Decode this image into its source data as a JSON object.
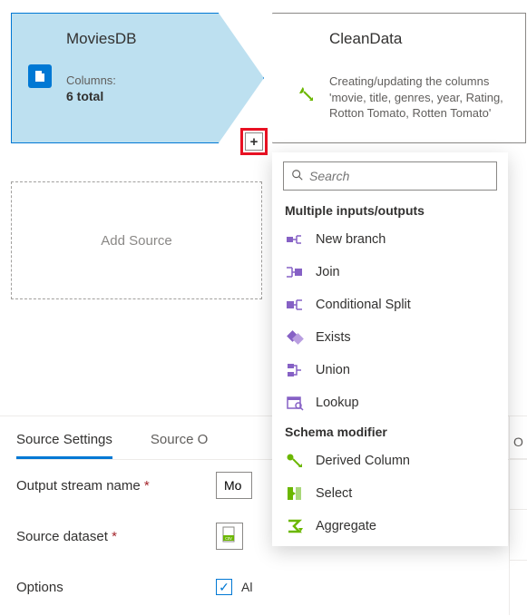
{
  "nodes": {
    "source": {
      "title": "MoviesDB",
      "columns_label": "Columns:",
      "columns_value": "6 total"
    },
    "step": {
      "title": "CleanData",
      "description": "Creating/updating the columns 'movie, title, genres, year, Rating, Rotton Tomato, Rotten Tomato'"
    }
  },
  "add_source_label": "Add Source",
  "dropdown": {
    "search_placeholder": "Search",
    "sections": {
      "multi": {
        "header": "Multiple inputs/outputs",
        "items": {
          "new_branch": "New branch",
          "join": "Join",
          "conditional_split": "Conditional Split",
          "exists": "Exists",
          "union": "Union",
          "lookup": "Lookup"
        }
      },
      "schema": {
        "header": "Schema modifier",
        "items": {
          "derived_column": "Derived Column",
          "select": "Select",
          "aggregate": "Aggregate"
        }
      }
    }
  },
  "settings": {
    "tabs": {
      "source_settings": "Source Settings",
      "source_options": "Source O"
    },
    "output_stream_label": "Output stream name",
    "output_stream_value": "Mo",
    "source_dataset_label": "Source dataset",
    "options_label": "Options",
    "options_checkbox_label": "Al",
    "right_header": "O"
  },
  "colors": {
    "primary": "#0078d4",
    "purple": "#8661c5",
    "green": "#6bb700",
    "node_fill": "#bde0f0",
    "highlight": "#e81123"
  }
}
